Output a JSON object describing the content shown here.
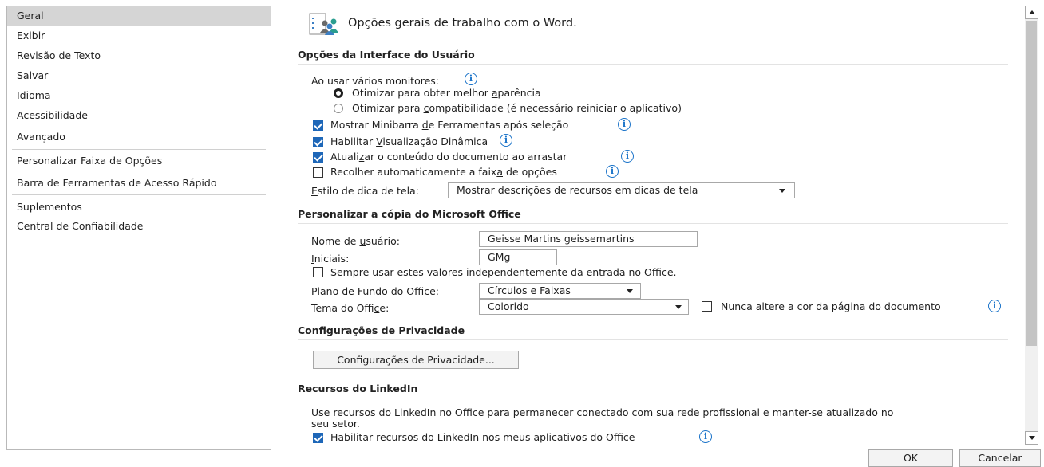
{
  "sidebar": {
    "items": [
      {
        "label": "Geral"
      },
      {
        "label": "Exibir"
      },
      {
        "label": "Revisão de Texto"
      },
      {
        "label": "Salvar"
      },
      {
        "label": "Idioma"
      },
      {
        "label": "Acessibilidade"
      },
      {
        "label": "Avançado"
      },
      {
        "label": "Personalizar Faixa de Opções"
      },
      {
        "label": "Barra de Ferramentas de Acesso Rápido"
      },
      {
        "label": "Suplementos"
      },
      {
        "label": "Central de Confiabilidade"
      }
    ]
  },
  "header": {
    "title": "Opções gerais de trabalho com o Word."
  },
  "ui_options": {
    "section_title": "Opções da Interface do Usuário",
    "monitors_label": "Ao usar vários monitores:",
    "radio_optimize_appearance": {
      "pre": "Otimizar para obter melhor ",
      "u": "a",
      "post": "parência"
    },
    "radio_optimize_compat": {
      "pre": "Otimizar para ",
      "u": "c",
      "post": "ompatibilidade (é necessário reiniciar o aplicativo)"
    },
    "cb_minibar": {
      "pre": "Mostrar Minibarra ",
      "u": "d",
      "post": "e Ferramentas após seleção"
    },
    "cb_live_preview": {
      "pre": "Habilitar ",
      "u": "V",
      "post": "isualização Dinâmica"
    },
    "cb_update_drag": {
      "pre": "Atuali",
      "u": "z",
      "post": "ar o conteúdo do documento ao arrastar"
    },
    "cb_collapse_ribbon": {
      "pre": "Recolher automaticamente a faix",
      "u": "a",
      "post": " de opções"
    },
    "screentip_label": {
      "pre": "",
      "u": "E",
      "post": "stilo de dica de tela:"
    },
    "screentip_value": "Mostrar descrições de recursos em dicas de tela"
  },
  "personalize": {
    "section_title": "Personalizar a cópia do Microsoft Office",
    "username_label": {
      "pre": "Nome de ",
      "u": "u",
      "post": "suário:"
    },
    "username_value": "Geisse Martins geissemartins",
    "initials_label": {
      "pre": "",
      "u": "I",
      "post": "niciais:"
    },
    "initials_value": "GMg",
    "cb_always_use": {
      "pre": "",
      "u": "S",
      "post": "empre usar estes valores independentemente da entrada no Office."
    },
    "background_label": {
      "pre": "Plano de ",
      "u": "F",
      "post": "undo do Office:"
    },
    "background_value": "Círculos e Faixas",
    "theme_label": {
      "pre": "Tema do Offi",
      "u": "c",
      "post": "e:"
    },
    "theme_value": "Colorido",
    "cb_never_change": "Nunca altere a cor da página do documento"
  },
  "privacy": {
    "section_title": "Configurações de Privacidade",
    "button": "Configurações de Privacidade..."
  },
  "linkedin": {
    "section_title": "Recursos do LinkedIn",
    "description_line1": "Use recursos do LinkedIn no Office para permanecer conectado com sua rede profissional e manter-se atualizado no",
    "description_line2": "seu setor.",
    "cb_enable": "Habilitar recursos do LinkedIn nos meus aplicativos do Office"
  },
  "footer": {
    "ok": "OK",
    "cancel": "Cancelar"
  },
  "info_glyph": "i",
  "colors": {
    "accent": "#1e67b8",
    "info": "#1a73c9",
    "selected": "#d5d5d5"
  }
}
